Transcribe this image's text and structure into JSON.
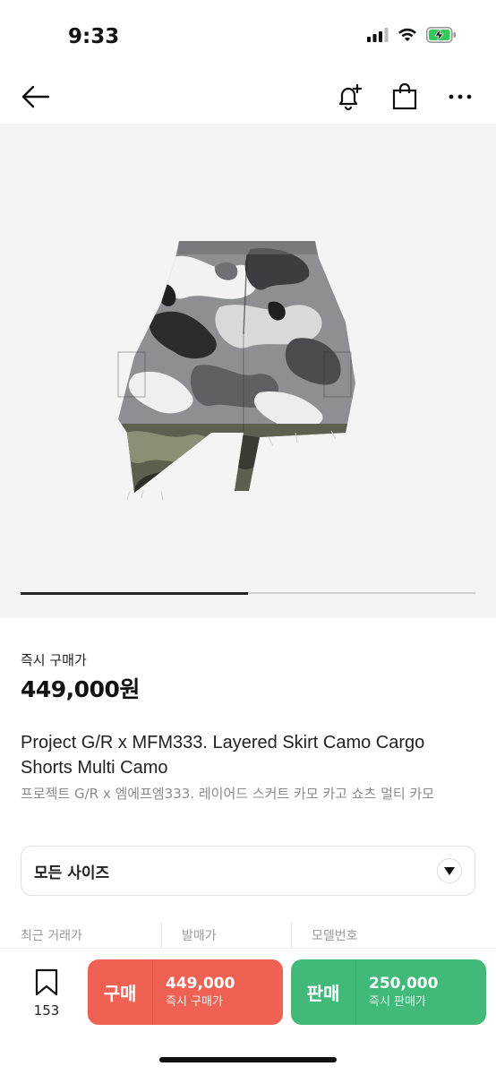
{
  "status_bar": {
    "time": "9:33"
  },
  "icons": {
    "back": "arrow-left-icon",
    "notify": "bell-plus-icon",
    "bag": "shopping-bag-icon",
    "more": "more-dots-icon",
    "chevron": "chevron-down-icon",
    "bookmark": "bookmark-icon"
  },
  "gallery": {
    "image_alt": "Layered skirt camo cargo shorts",
    "indicator_progress": 0.5
  },
  "price": {
    "label": "즉시 구매가",
    "value": "449,000원"
  },
  "product": {
    "title_en": "Project G/R x MFM333. Layered Skirt Camo Cargo Shorts Multi Camo",
    "title_ko": "프로젝트 G/R x 엠에프엠333. 레이어드 스커트 카모 카고 쇼츠 멀티 카모"
  },
  "size_selector": {
    "label": "모든 사이즈"
  },
  "info_headers": [
    "최근 거래가",
    "발매가",
    "모델번호"
  ],
  "bottom_bar": {
    "wish_count": "153",
    "buy": {
      "title": "구매",
      "price": "449,000",
      "sub": "즉시 구매가"
    },
    "sell": {
      "title": "판매",
      "price": "250,000",
      "sub": "즉시 판매가"
    }
  },
  "colors": {
    "buy": "#ef6253",
    "sell": "#41b979"
  }
}
